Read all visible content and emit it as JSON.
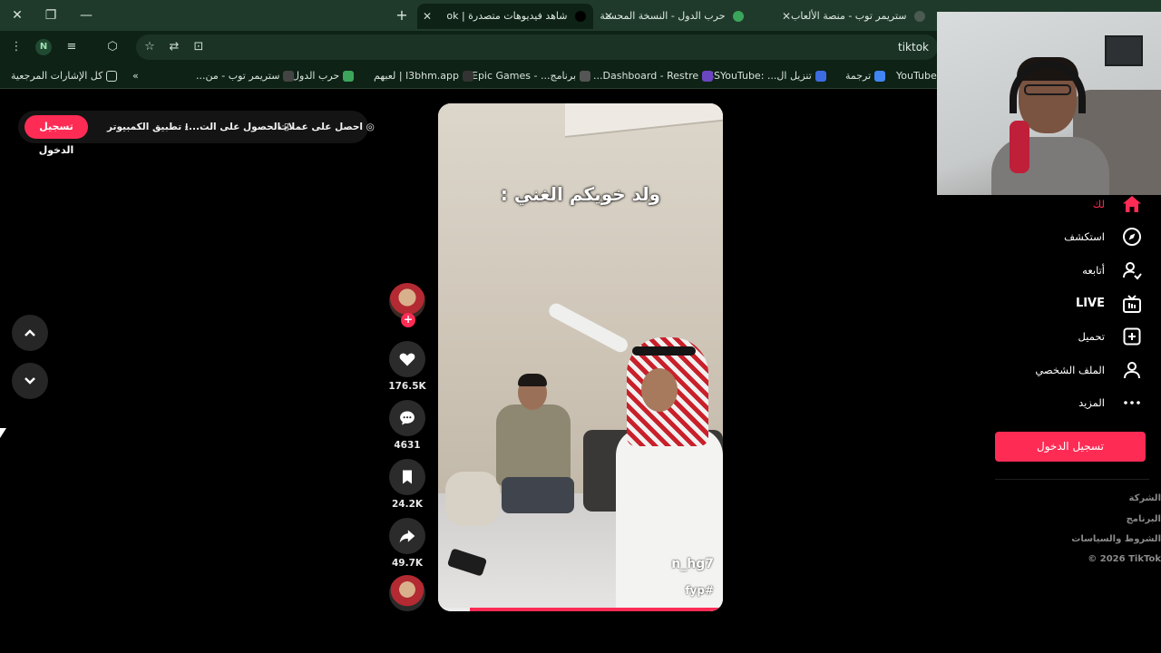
{
  "browser": {
    "tabs": [
      {
        "label": "ستريمر توب - منصة الألعاب"
      },
      {
        "label": "حرب الدول - النسخة المحسنة"
      },
      {
        "label": "شاهد فيديوهات متصدرة | ok"
      }
    ],
    "url": "tiktok",
    "profile_initial": "N",
    "bookmarks": {
      "all_bookmarks": "كل الإشارات المرجعية",
      "items": [
        "YouTube",
        "ترجمة",
        "تنزيل ال... :SSYouTube",
        "Dashboard - Restre...",
        "برنامج... - Epic Games",
        "l3bhm.app | لعبهم",
        "حرب الدول",
        "ستريمر توب - من..."
      ]
    }
  },
  "topbar": {
    "login": "تسجيل الدخول",
    "desktop_app": "تطبيق الكمبيوتر",
    "get_app": "الحصول على الت...",
    "get_coins": "احصل على عملات"
  },
  "video": {
    "caption": "ولد خويكم الغني :",
    "author": "n_hg7",
    "hashtag": "fyp#",
    "progress": 0.89
  },
  "actions": {
    "likes": "176.5K",
    "comments": "4631",
    "saves": "24.2K",
    "shares": "49.7K"
  },
  "sidenav": {
    "items": [
      {
        "label": "لك",
        "icon": "home-icon"
      },
      {
        "label": "استكشف",
        "icon": "compass-icon"
      },
      {
        "label": "أتابعه",
        "icon": "following-icon"
      },
      {
        "label": "LIVE",
        "icon": "live-icon"
      },
      {
        "label": "تحميل",
        "icon": "upload-icon"
      },
      {
        "label": "الملف الشخصي",
        "icon": "profile-icon"
      },
      {
        "label": "المزيد",
        "icon": "more-icon"
      }
    ],
    "login": "تسجيل الدخول",
    "footer": [
      "الشركة",
      "البرنامج",
      "الشروط والسياسات",
      "© 2026 TikTok"
    ]
  },
  "colors": {
    "accent": "#fe2c55",
    "chrome": "#1f3a2b"
  }
}
